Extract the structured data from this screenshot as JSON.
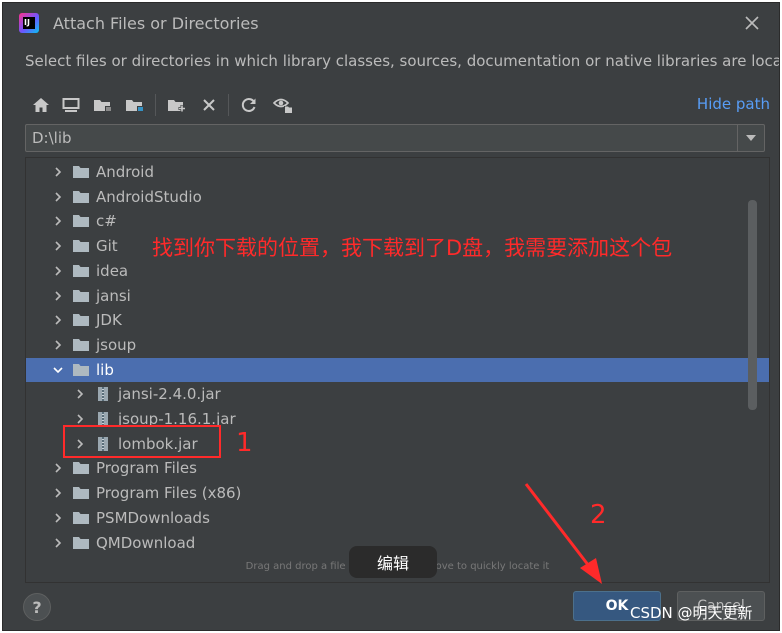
{
  "dialog": {
    "title": "Attach Files or Directories",
    "description": "Select files or directories in which library classes, sources, documentation or native libraries are located"
  },
  "toolbar": {
    "buttons": [
      {
        "name": "home-icon"
      },
      {
        "name": "desktop-icon"
      },
      {
        "name": "project-folder-icon"
      },
      {
        "name": "module-folder-icon"
      },
      {
        "name": "new-folder-icon"
      },
      {
        "name": "delete-icon"
      },
      {
        "name": "refresh-icon"
      },
      {
        "name": "show-hidden-icon"
      }
    ],
    "hide_path_label": "Hide path"
  },
  "path": {
    "value": "D:\\lib"
  },
  "tree": {
    "items": [
      {
        "label": "Android",
        "level": 0,
        "type": "folder",
        "expanded": false
      },
      {
        "label": "AndroidStudio",
        "level": 0,
        "type": "folder",
        "expanded": false
      },
      {
        "label": "c#",
        "level": 0,
        "type": "folder",
        "expanded": false
      },
      {
        "label": "Git",
        "level": 0,
        "type": "folder",
        "expanded": false
      },
      {
        "label": "idea",
        "level": 0,
        "type": "folder",
        "expanded": false
      },
      {
        "label": "jansi",
        "level": 0,
        "type": "folder",
        "expanded": false
      },
      {
        "label": "JDK",
        "level": 0,
        "type": "folder",
        "expanded": false
      },
      {
        "label": "jsoup",
        "level": 0,
        "type": "folder",
        "expanded": false
      },
      {
        "label": "lib",
        "level": 0,
        "type": "folder",
        "expanded": true,
        "selected": true
      },
      {
        "label": "jansi-2.4.0.jar",
        "level": 1,
        "type": "jar",
        "expanded": false
      },
      {
        "label": "jsoup-1.16.1.jar",
        "level": 1,
        "type": "jar",
        "expanded": false
      },
      {
        "label": "lombok.jar",
        "level": 1,
        "type": "jar",
        "expanded": false
      },
      {
        "label": "Program Files",
        "level": 0,
        "type": "folder",
        "expanded": false
      },
      {
        "label": "Program Files (x86)",
        "level": 0,
        "type": "folder",
        "expanded": false
      },
      {
        "label": "PSMDownloads",
        "level": 0,
        "type": "folder",
        "expanded": false
      },
      {
        "label": "QMDownload",
        "level": 0,
        "type": "folder",
        "expanded": false
      }
    ]
  },
  "hint": "Drag and drop a file into the space above to quickly locate it",
  "buttons": {
    "help": "?",
    "ok": "OK",
    "cancel": "Cancel"
  },
  "annotations": {
    "instruction": "找到你下载的位置，我下载到了D盘，我需要添加这个包",
    "step1": "1",
    "step2": "2",
    "tooltip": "编辑",
    "watermark": "CSDN @明天更新"
  },
  "colors": {
    "background": "#3c3f41",
    "selection": "#4b6eaf",
    "link": "#589df6",
    "annotation": "#ff2a2a"
  }
}
